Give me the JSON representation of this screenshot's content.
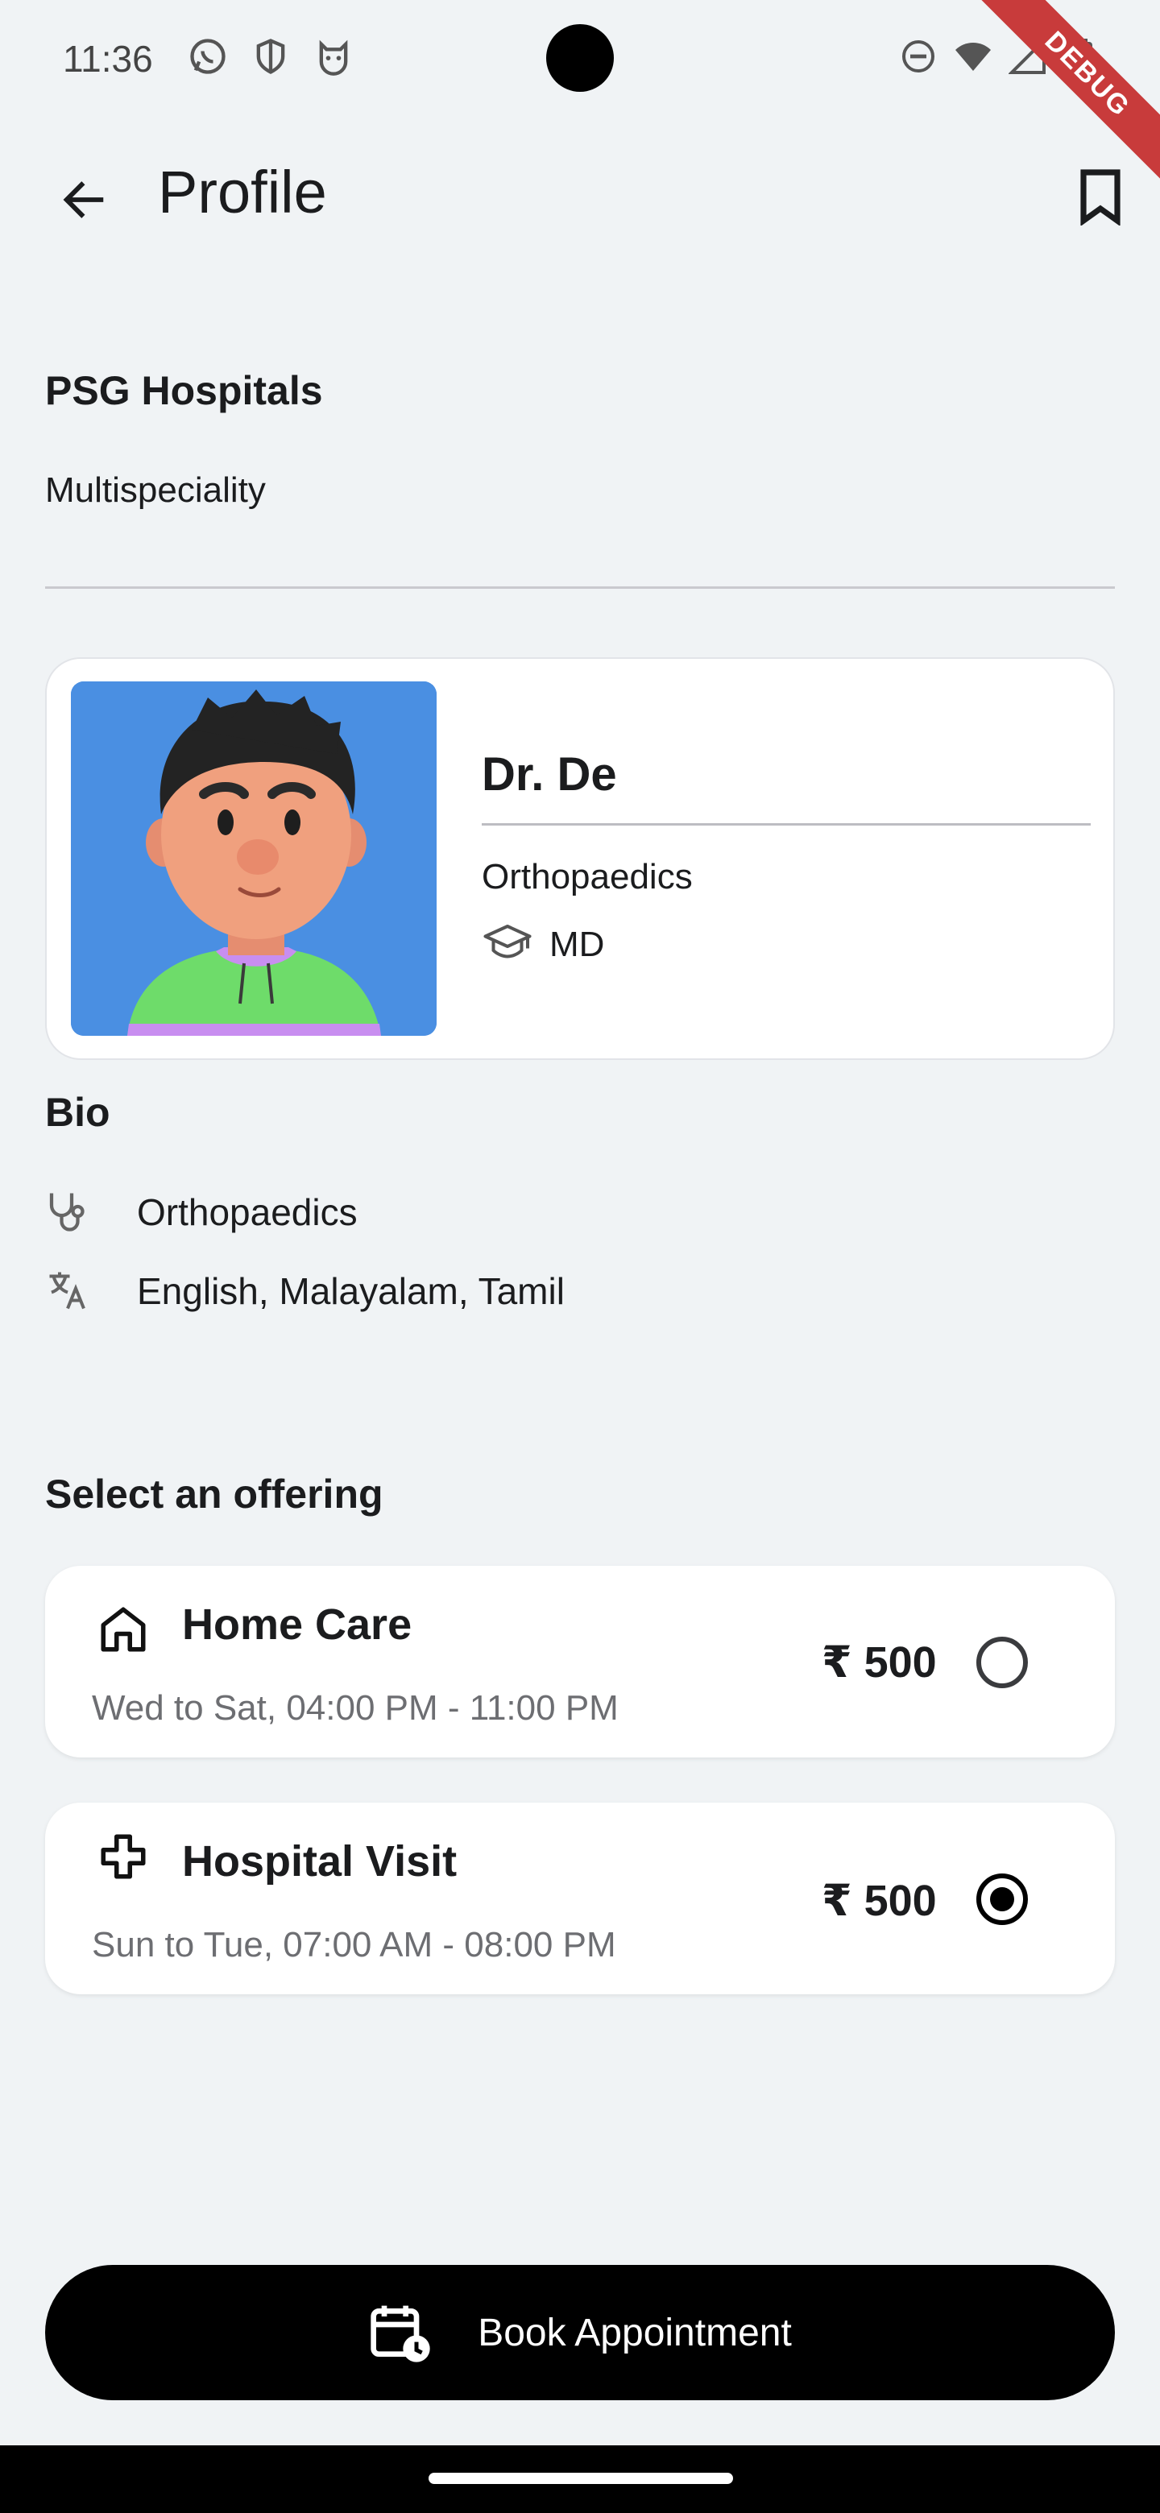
{
  "status_bar": {
    "time": "11:36",
    "left_icons": [
      "whatsapp-icon",
      "shield-icon",
      "cat-face-icon"
    ],
    "right_icons": [
      "do-not-disturb-icon",
      "wifi-icon",
      "cellular-signal-icon",
      "battery-icon"
    ],
    "debug_label": "DEBUG"
  },
  "app_bar": {
    "title": "Profile",
    "back_icon": "arrow-back-icon",
    "action_icon": "bookmark-icon"
  },
  "hospital": {
    "name": "PSG Hospitals",
    "type": "Multispeciality"
  },
  "doctor": {
    "name": "Dr. De",
    "speciality": "Orthopaedics",
    "degree": "MD",
    "degree_icon": "graduation-cap-icon",
    "avatar_bg": "#4a8fe2"
  },
  "bio": {
    "heading": "Bio",
    "items": [
      {
        "icon": "stethoscope-icon",
        "text": "Orthopaedics"
      },
      {
        "icon": "translate-icon",
        "text": "English, Malayalam, Tamil"
      }
    ]
  },
  "offerings": {
    "heading": "Select an offering",
    "items": [
      {
        "icon": "home-icon",
        "title": "Home Care",
        "schedule": "Wed to Sat, 04:00 PM - 11:00 PM",
        "price": "₹ 500",
        "selected": false
      },
      {
        "icon": "medical-cross-icon",
        "title": "Hospital Visit",
        "schedule": "Sun to Tue, 07:00 AM - 08:00 PM",
        "price": "₹ 500",
        "selected": true
      }
    ]
  },
  "book_button": {
    "label": "Book Appointment",
    "icon": "calendar-clock-icon"
  },
  "colors": {
    "background": "#f0f3f5",
    "card": "#ffffff",
    "primary": "#000000",
    "debug_ribbon": "#c83b3b"
  }
}
